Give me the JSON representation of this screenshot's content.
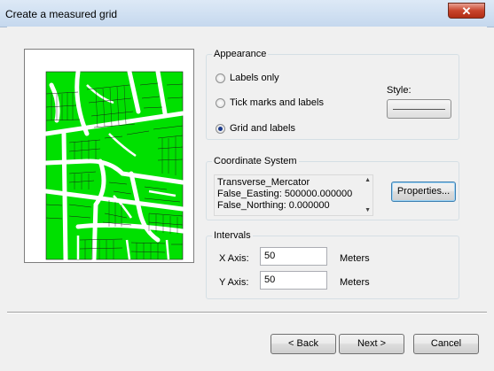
{
  "window": {
    "title": "Create a measured grid",
    "close_glyph": "✕"
  },
  "appearance": {
    "label": "Appearance",
    "options": [
      {
        "label": "Labels only",
        "checked": false
      },
      {
        "label": "Tick marks and labels",
        "checked": false
      },
      {
        "label": "Grid and labels",
        "checked": true
      }
    ],
    "style_label": "Style:"
  },
  "coordinate_system": {
    "label": "Coordinate System",
    "lines": [
      "Transverse_Mercator",
      "False_Easting: 500000.000000",
      "False_Northing: 0.000000"
    ],
    "properties_button": "Properties..."
  },
  "intervals": {
    "label": "Intervals",
    "x_label": "X Axis:",
    "x_value": "50",
    "x_unit": "Meters",
    "y_label": "Y Axis:",
    "y_value": "50",
    "y_unit": "Meters"
  },
  "buttons": {
    "back": "< Back",
    "next": "Next >",
    "cancel": "Cancel"
  },
  "colors": {
    "parcel": "#00e000",
    "parcel_outline": "#1a1a1a",
    "road": "#ffffff"
  }
}
